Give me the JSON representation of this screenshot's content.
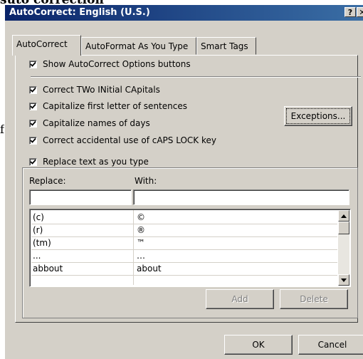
{
  "background": {
    "top_text": "suto correction",
    "side_text": "f"
  },
  "window": {
    "title": "AutoCorrect: English (U.S.)",
    "help_label": "?",
    "close_label": "✕"
  },
  "tabs": [
    {
      "label": "AutoCorrect",
      "active": true
    },
    {
      "label": "AutoFormat As You Type",
      "active": false
    },
    {
      "label": "Smart Tags",
      "active": false
    }
  ],
  "options": {
    "show_buttons": {
      "label": "Show AutoCorrect Options buttons",
      "checked": true
    },
    "two_initial_caps": {
      "label": "Correct TWo INitial CApitals",
      "checked": true
    },
    "capitalize_sentences": {
      "label": "Capitalize first letter of sentences",
      "checked": true
    },
    "capitalize_days": {
      "label": "Capitalize names of days",
      "checked": true
    },
    "caps_lock": {
      "label": "Correct accidental use of cAPS LOCK key",
      "checked": true
    },
    "replace_text": {
      "label": "Replace text as you type",
      "checked": true
    }
  },
  "buttons": {
    "exceptions": "Exceptions...",
    "add": "Add",
    "delete": "Delete",
    "ok": "OK",
    "cancel": "Cancel"
  },
  "replace_section": {
    "replace_label": "Replace:",
    "with_label": "With:",
    "replace_value": "",
    "with_value": ""
  },
  "entries": [
    {
      "replace": "(c)",
      "with": "©"
    },
    {
      "replace": "(r)",
      "with": "®"
    },
    {
      "replace": "(tm)",
      "with": "™"
    },
    {
      "replace": "...",
      "with": "…"
    },
    {
      "replace": "abbout",
      "with": "about"
    }
  ],
  "colors": {
    "title_start": "#0a246a",
    "title_end": "#3a6ea5",
    "face": "#d4d0c8"
  }
}
